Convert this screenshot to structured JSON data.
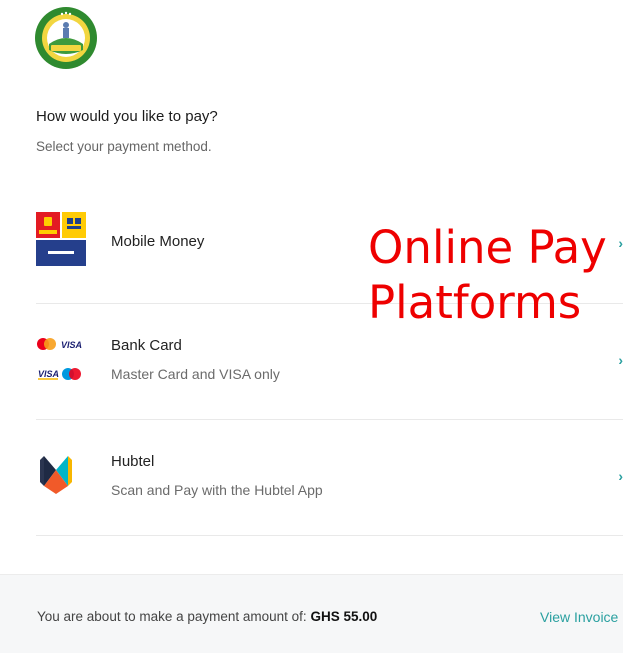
{
  "logo": {
    "icon": "lands-commission-ghana-seal",
    "text": "LANDS COMMISSION GHANA"
  },
  "header": {
    "title": "How would you like to pay?",
    "subtitle": "Select your payment method."
  },
  "methods": [
    {
      "icon": "mobile-money-logos",
      "title": "Mobile Money",
      "description": ""
    },
    {
      "icon": "mastercard-visa-logos",
      "title": "Bank Card",
      "description": "Master Card and VISA only"
    },
    {
      "icon": "hubtel-logo",
      "title": "Hubtel",
      "description": "Scan and Pay with the Hubtel App"
    }
  ],
  "overlay": {
    "line1": "Online Pay",
    "line2": "Platforms"
  },
  "footer": {
    "amount_prefix": "You are about to make a payment amount of:",
    "amount_value": "GHS 55.00",
    "view_invoice": "View Invoice"
  },
  "colors": {
    "accent": "#2aa0a0",
    "overlay_text": "#ee0000",
    "footer_bg": "#f6f7f8"
  }
}
